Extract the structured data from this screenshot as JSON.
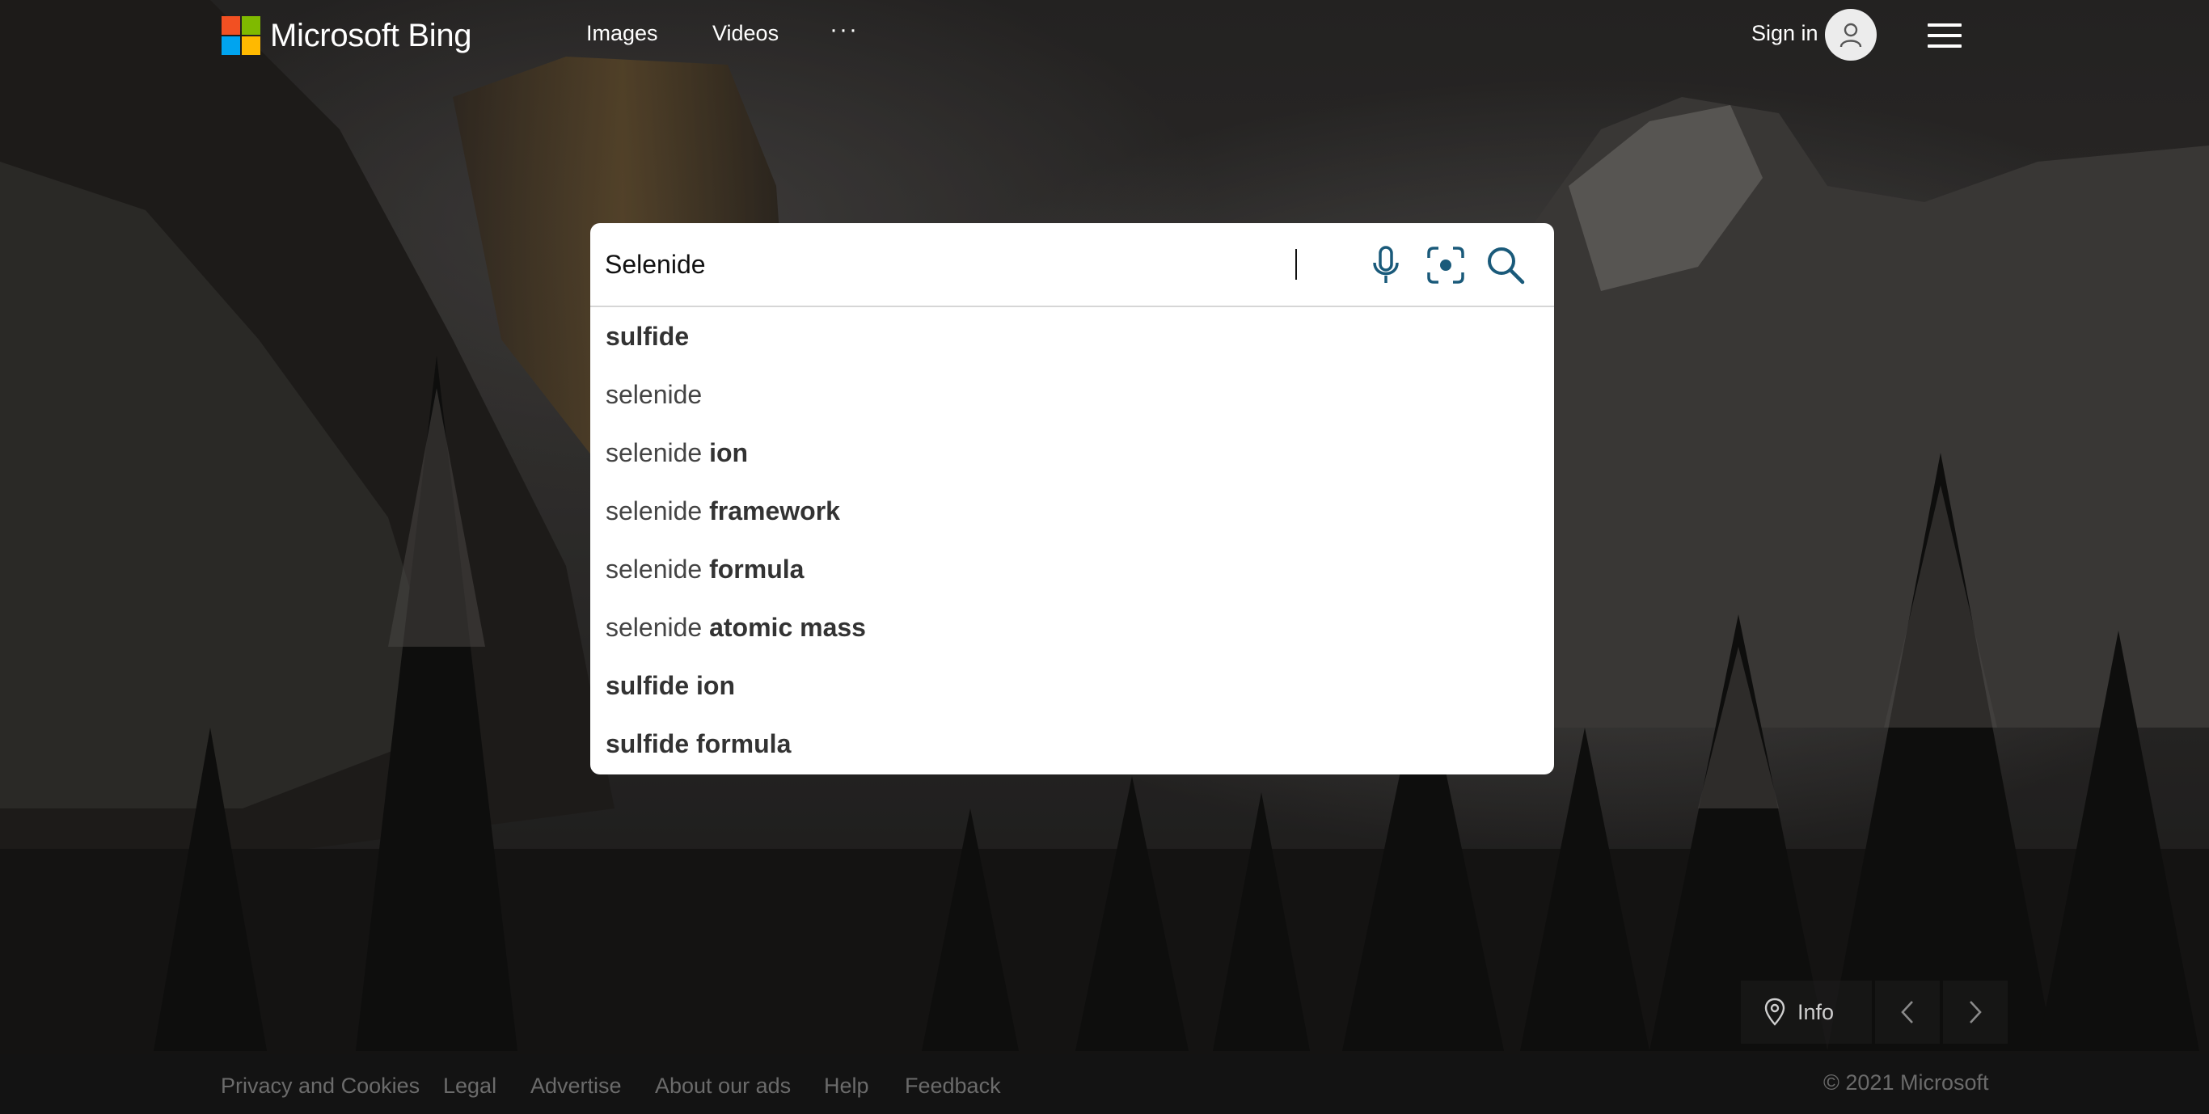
{
  "header": {
    "brand": "Microsoft Bing",
    "nav_images": "Images",
    "nav_videos": "Videos",
    "nav_more": "···",
    "sign_in": "Sign in",
    "brand_colors": [
      "#f25022",
      "#7fba00",
      "#00a4ef",
      "#ffb900"
    ]
  },
  "search": {
    "value": "Selenide",
    "icons": [
      "microphone-icon",
      "visual-search-icon",
      "search-icon"
    ],
    "accent_color": "#1a5a7a",
    "suggestions": [
      {
        "prefix": "",
        "bold": "sulfide"
      },
      {
        "prefix": "selenide",
        "bold": ""
      },
      {
        "prefix": "selenide ",
        "bold": "ion"
      },
      {
        "prefix": "selenide ",
        "bold": "framework"
      },
      {
        "prefix": "selenide ",
        "bold": "formula"
      },
      {
        "prefix": "selenide ",
        "bold": "atomic mass"
      },
      {
        "prefix": "",
        "bold": "sulfide ion"
      },
      {
        "prefix": "",
        "bold": "sulfide formula"
      }
    ]
  },
  "image_controls": {
    "info_label": "Info",
    "icons": [
      "location-pin-icon",
      "chevron-left-icon",
      "chevron-right-icon"
    ]
  },
  "footer": {
    "links": [
      "Privacy and Cookies",
      "Legal",
      "Advertise",
      "About our ads",
      "Help",
      "Feedback"
    ],
    "copyright": "© 2021 Microsoft"
  }
}
